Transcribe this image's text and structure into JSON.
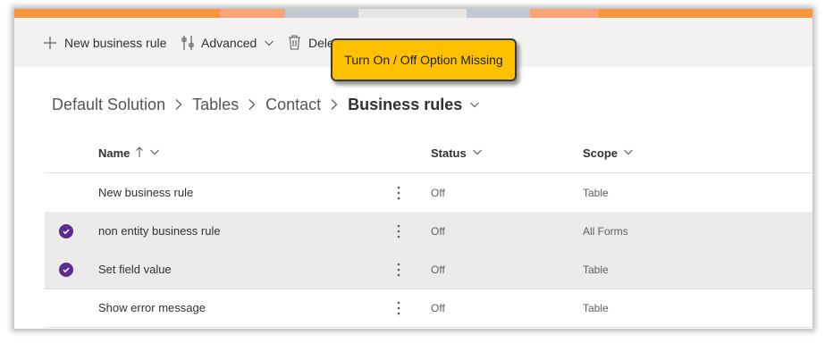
{
  "colors": {
    "accent_purple": "#5c2d91",
    "callout_yellow": "#ffc000",
    "banner": [
      "#f7963b",
      "#f9a477",
      "#c2c9d0",
      "#e8e6e4",
      "#c2c9d0",
      "#f9a477",
      "#f7963b"
    ]
  },
  "toolbar": {
    "new_rule_label": "New business rule",
    "advanced_label": "Advanced",
    "delete_label": "Delete"
  },
  "callout": {
    "text": "Turn On / Off Option Missing"
  },
  "breadcrumb": {
    "items": [
      "Default Solution",
      "Tables",
      "Contact"
    ],
    "current": "Business rules"
  },
  "columns": {
    "name": "Name",
    "status": "Status",
    "scope": "Scope"
  },
  "rows": [
    {
      "name": "New business rule",
      "status": "Off",
      "scope": "Table",
      "selected": false
    },
    {
      "name": "non entity business rule",
      "status": "Off",
      "scope": "All Forms",
      "selected": true
    },
    {
      "name": "Set field value",
      "status": "Off",
      "scope": "Table",
      "selected": true
    },
    {
      "name": "Show error message",
      "status": "Off",
      "scope": "Table",
      "selected": false
    }
  ]
}
